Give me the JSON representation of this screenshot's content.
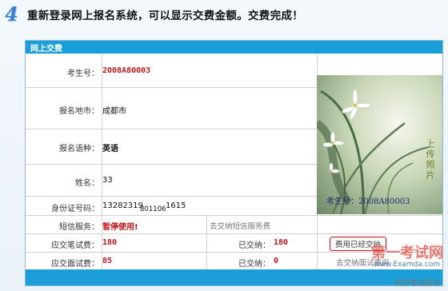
{
  "step": {
    "number": "4",
    "title": "重新登录网上报名系统，可以显示交费金额。交费完成！"
  },
  "panel": {
    "title": "网上交费"
  },
  "form": {
    "exam_no_label": "考生号：",
    "exam_no": "2008A80003",
    "city_label": "报名地市：",
    "city": "成都市",
    "language_label": "报名语种：",
    "language": "英语",
    "name_label": "姓名：",
    "name": "33",
    "id_label": "身份证号码：",
    "id_part1": "13282319",
    "id_part2": "801106",
    "id_part3": "1615",
    "sms_label": "短信服务：",
    "sms_status": "暂停使用!",
    "sms_link": "去交纳短信服务费",
    "written_fee_label": "应交笔试费：",
    "written_fee": "180",
    "written_paid_label": "已交纳：",
    "written_paid": "180",
    "written_btn": "费用已经交纳",
    "oral_fee_label": "应交面试费：",
    "oral_fee": "85",
    "oral_paid_label": "已交纳：",
    "oral_paid": "0",
    "oral_link": "去交纳面试费用"
  },
  "photo": {
    "caption": "考生号：2008A80003",
    "motto": "上传照片"
  },
  "watermark": {
    "brand": "第一考试网",
    "site": "www.Examda.com",
    "slogan": "祝您考试成功"
  },
  "colors": {
    "header_bar": "#1a9fd8",
    "accent_red": "#c0141a",
    "step_blue": "#3a7ed0"
  }
}
